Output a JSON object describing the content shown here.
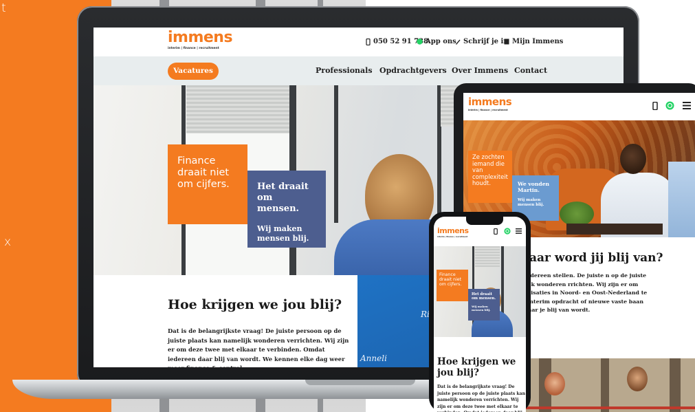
{
  "backdrop": {
    "side_letters": [
      "t",
      "x"
    ]
  },
  "brand": {
    "logo": "immens",
    "tagline": "interim | finance | recruitment",
    "color_orange": "#f47b20",
    "color_blue": "#4d5e8f"
  },
  "laptop": {
    "top_links": [
      {
        "icon": "phone-icon",
        "label": "050 52 91 738"
      },
      {
        "icon": "whatsapp-icon",
        "label": "App ons"
      },
      {
        "icon": "pencil-icon",
        "label": "Schrijf je in"
      },
      {
        "icon": "login-icon",
        "label": "Mijn Immens"
      }
    ],
    "nav": {
      "cta": "Vacatures",
      "links": [
        "Professionals",
        "Opdrachtgevers",
        "Over Immens",
        "Contact"
      ]
    },
    "hero": {
      "orange_bubble": "Finance draait niet om cijfers.",
      "blue_bubble_title": "Het draait om mensen.",
      "blue_bubble_sub": "Wij maken mensen blij."
    },
    "intro": {
      "heading": "Hoe krijgen we jou blij?",
      "body": "Dat is de belangrijkste vraag! De juiste persoon op de juiste plaats kan namelijk wonderen verrichten. Wij zijn er om deze twee met elkaar te verbinden. Omdat iedereen daar blij van wordt. We kennen elke dag weer meer finance & control"
    },
    "scribbles": [
      "Richa",
      "Anneli"
    ]
  },
  "tablet": {
    "hero": {
      "orange_bubble": "Ze zochten iemand die van complexiteit houdt.",
      "blue_bubble_title": "We vonden Martin.",
      "blue_bubble_sub": "Wij maken mensen blij."
    },
    "content": {
      "heading": "aar word jij blij van?",
      "body": "e vraag die we aan iedereen stellen. De juiste n op de juiste plaats kan namelijk wonderen rrichten. Wij zijn er om mensen met leuke anisaties in Noord- en Oost-Nederland te en. Wij vinden een interim opdracht of nieuwe vaste baan waar je blij van wordt."
    }
  },
  "phone": {
    "hero": {
      "orange_bubble": "Finance draait niet om cijfers.",
      "blue_bubble_title": "Het draait om mensen.",
      "blue_bubble_sub": "Wij maken mensen blij."
    },
    "content": {
      "heading": "Hoe krijgen we jou blij?",
      "body": "Dat is de belangrijkste vraag! De juiste persoon op de juiste plaats kan namelijk wonderen verrichten. Wij zijn er om deze twee met elkaar te verbinden. Omdat iedereen daar blij van wordt. We kennen"
    }
  }
}
